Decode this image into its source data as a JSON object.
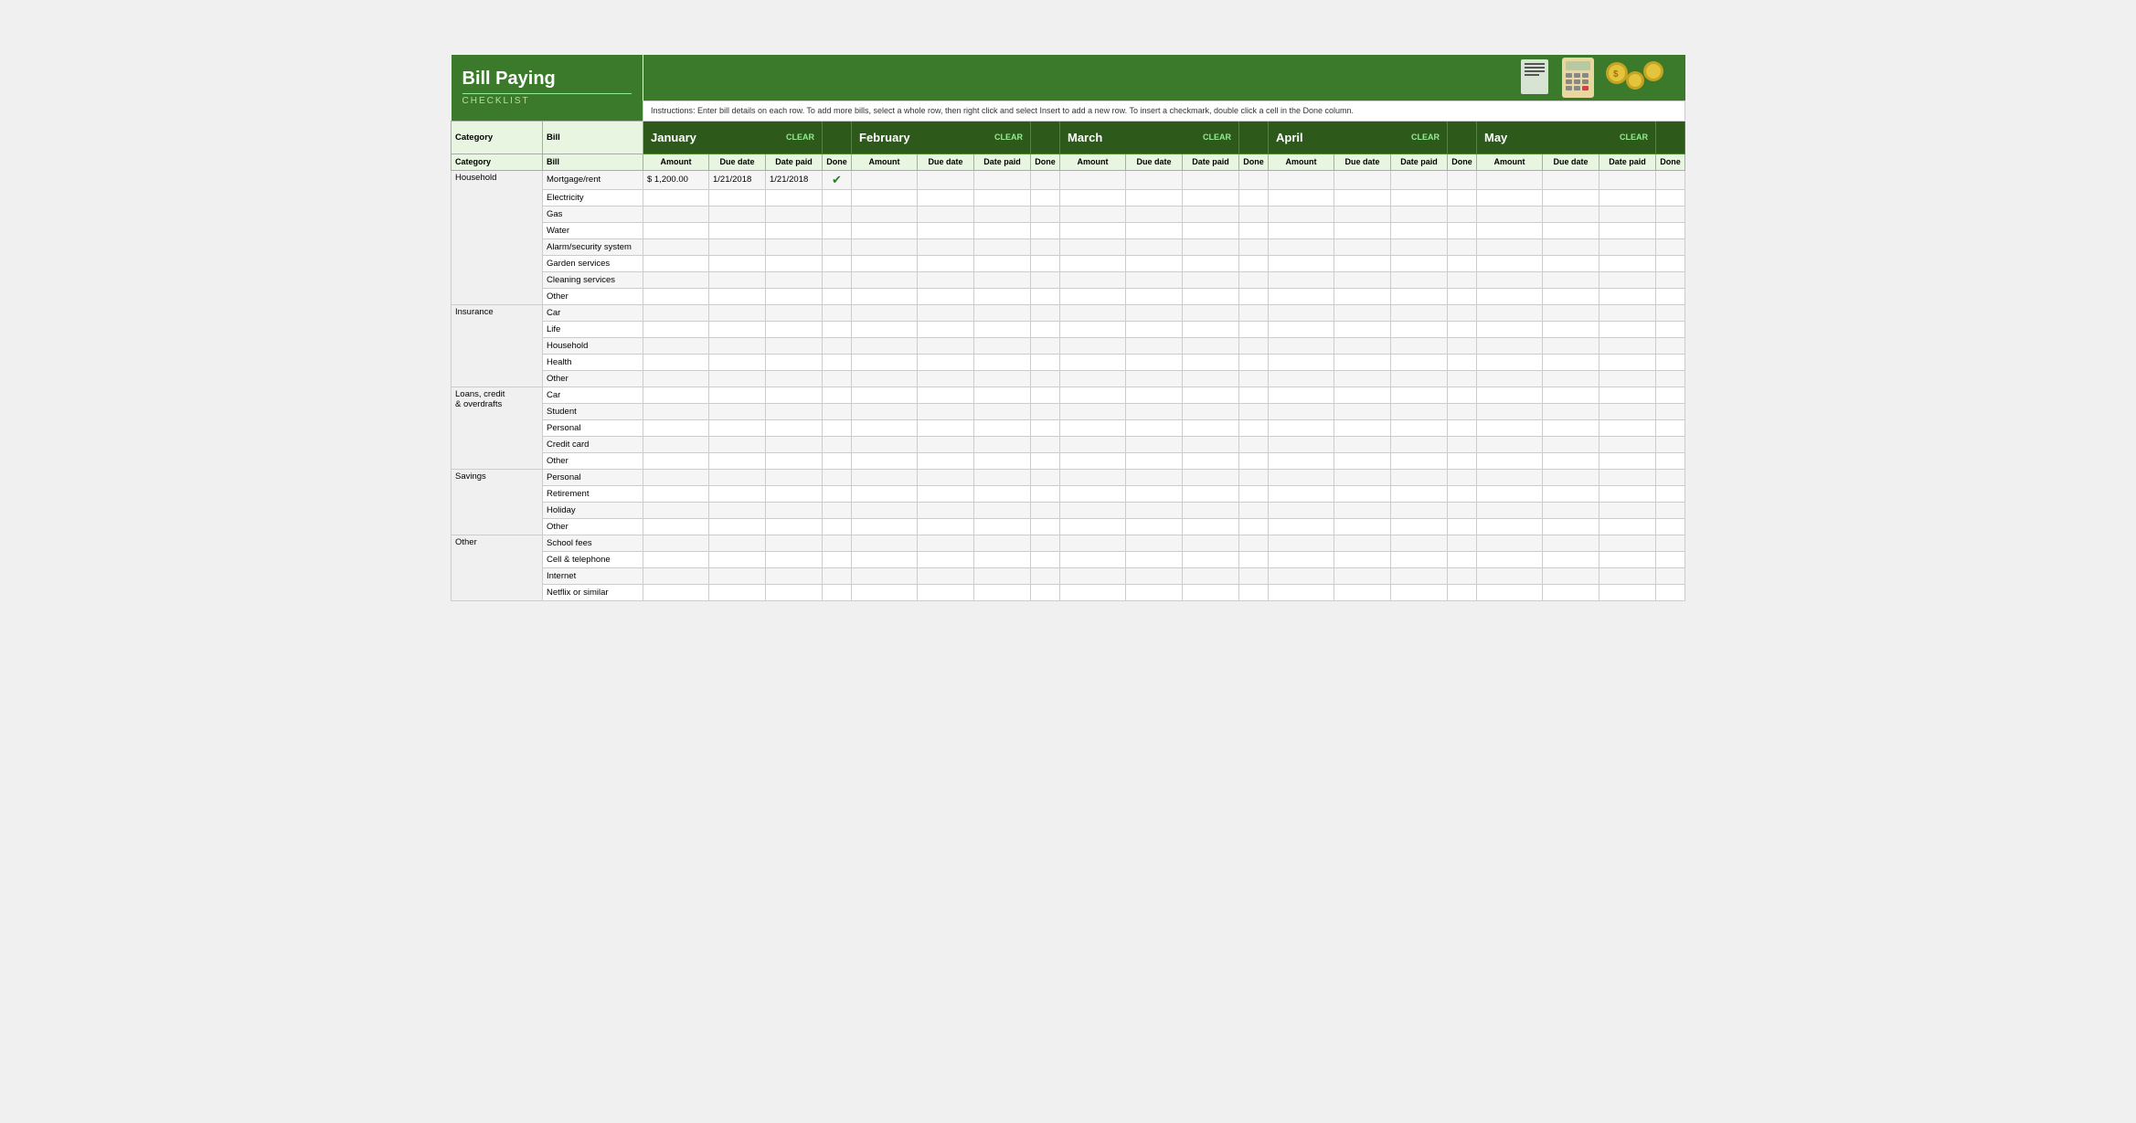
{
  "app": {
    "title": "Bill Paying",
    "subtitle": "CHECKLIST",
    "instructions": "Instructions: Enter bill details on each row. To add more bills, select a whole row, then right click and select Insert to add a new row. To insert a checkmark, double click a cell in the Done column."
  },
  "months": [
    {
      "name": "January",
      "clear": "CLEAR"
    },
    {
      "name": "February",
      "clear": "CLEAR"
    },
    {
      "name": "March",
      "clear": "CLEAR"
    },
    {
      "name": "April",
      "clear": "CLEAR"
    },
    {
      "name": "May",
      "clear": "CLEAR"
    }
  ],
  "col_headers": {
    "category": "Category",
    "bill": "Bill",
    "amount": "Amount",
    "due_date": "Due date",
    "date_paid": "Date paid",
    "done": "Done"
  },
  "rows": [
    {
      "category": "Household",
      "bill": "Mortgage/rent",
      "january": {
        "amount": "$  1,200.00",
        "due_date": "1/21/2018",
        "date_paid": "1/21/2018",
        "done": "✔"
      }
    },
    {
      "category": "",
      "bill": "Electricity"
    },
    {
      "category": "",
      "bill": "Gas"
    },
    {
      "category": "",
      "bill": "Water"
    },
    {
      "category": "",
      "bill": "Alarm/security system"
    },
    {
      "category": "",
      "bill": "Garden services"
    },
    {
      "category": "",
      "bill": "Cleaning services"
    },
    {
      "category": "",
      "bill": "Other"
    },
    {
      "category": "Insurance",
      "bill": "Car"
    },
    {
      "category": "",
      "bill": "Life"
    },
    {
      "category": "",
      "bill": "Household"
    },
    {
      "category": "",
      "bill": "Health"
    },
    {
      "category": "",
      "bill": "Other"
    },
    {
      "category": "Loans, credit\n& overdrafts",
      "bill": "Car"
    },
    {
      "category": "",
      "bill": "Student"
    },
    {
      "category": "",
      "bill": "Personal"
    },
    {
      "category": "",
      "bill": "Credit card"
    },
    {
      "category": "",
      "bill": "Other"
    },
    {
      "category": "Savings",
      "bill": "Personal"
    },
    {
      "category": "",
      "bill": "Retirement"
    },
    {
      "category": "",
      "bill": "Holiday"
    },
    {
      "category": "",
      "bill": "Other"
    },
    {
      "category": "Other",
      "bill": "School fees"
    },
    {
      "category": "",
      "bill": "Cell & telephone"
    },
    {
      "category": "",
      "bill": "Internet"
    },
    {
      "category": "",
      "bill": "Netflix or similar"
    }
  ],
  "colors": {
    "header_bg": "#3a7a2a",
    "month_bg": "#2d5a1b",
    "col_header_bg": "#e8f5e0",
    "row_even": "#f0f0f0",
    "row_odd": "#ffffff",
    "clear_color": "#90ee90",
    "checkmark_color": "#2d7a2d"
  }
}
